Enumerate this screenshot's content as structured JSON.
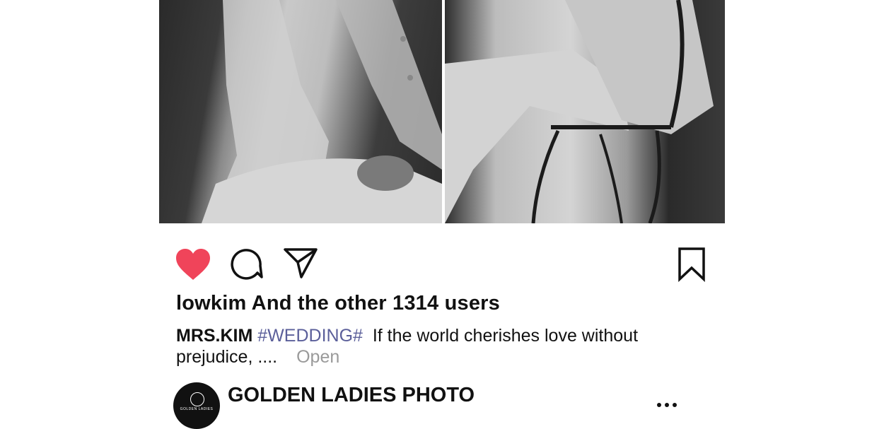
{
  "post": {
    "image_left_alt": "Black-and-white photo of a man in a light suit",
    "image_right_alt": "Black-and-white photo of a man in a light suit sitting on a bentwood chair",
    "likes_text": "lowkim And the other 1314 users",
    "caption": {
      "username": "MRS.KIM",
      "hashtag": "#WEDDING#",
      "text": "If the world cherishes love without prejudice, ....",
      "open_label": "Open"
    }
  },
  "actions": {
    "like_icon": "heart-icon",
    "like_color": "#f0445a",
    "comment_icon": "speech-bubble-icon",
    "share_icon": "paper-plane-icon",
    "save_icon": "bookmark-icon"
  },
  "account": {
    "name": "GOLDEN LADIES PHOTO",
    "avatar_text": "GOLDEN LADIES",
    "more_icon": "more-dots-icon"
  }
}
